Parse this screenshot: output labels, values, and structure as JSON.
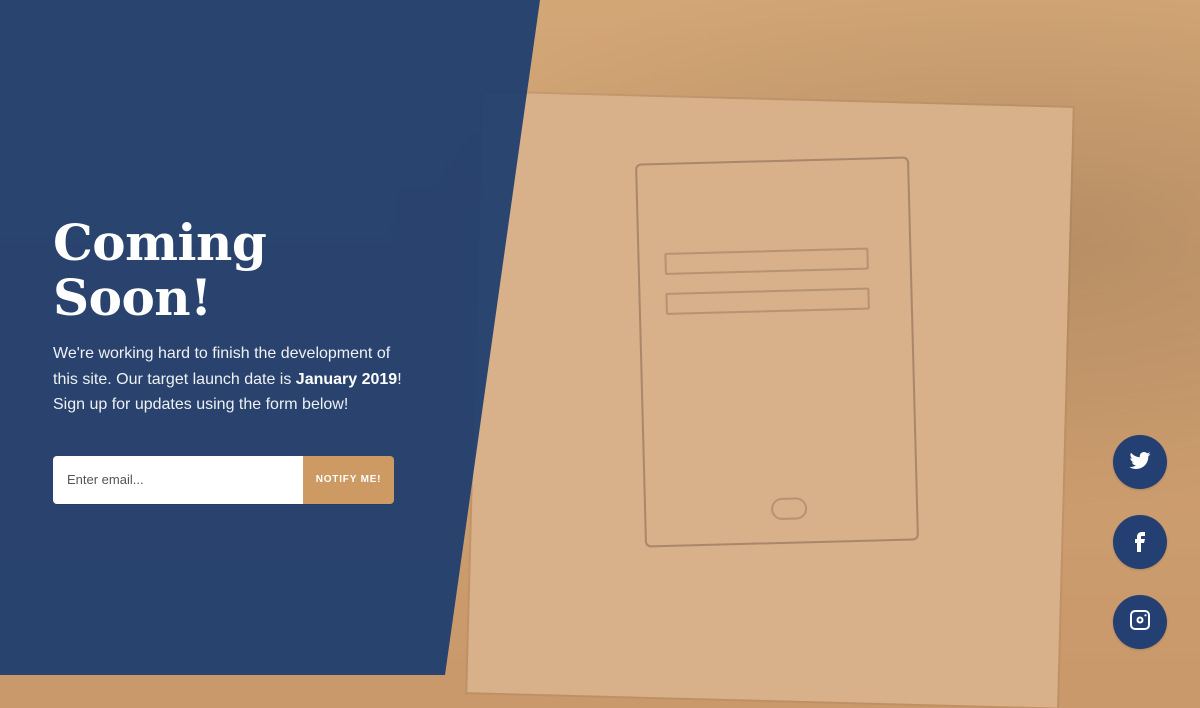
{
  "hero": {
    "title": "Coming Soon!",
    "description": {
      "part1": "We're working hard to finish the development of this site. Our target launch date is ",
      "launch_date": "January 2019",
      "part2": "! Sign up for updates using the form below!"
    }
  },
  "form": {
    "email_placeholder": "Enter email...",
    "button_label": "NOTIFY ME!"
  },
  "social": {
    "items": [
      {
        "name": "twitter",
        "icon": "twitter-icon"
      },
      {
        "name": "facebook",
        "icon": "facebook-icon"
      },
      {
        "name": "instagram",
        "icon": "instagram-icon"
      }
    ]
  },
  "colors": {
    "overlay_blue": "#1c3c6e",
    "accent": "#cc9a62",
    "social_bg": "#243f72",
    "background": "#c9996b"
  }
}
